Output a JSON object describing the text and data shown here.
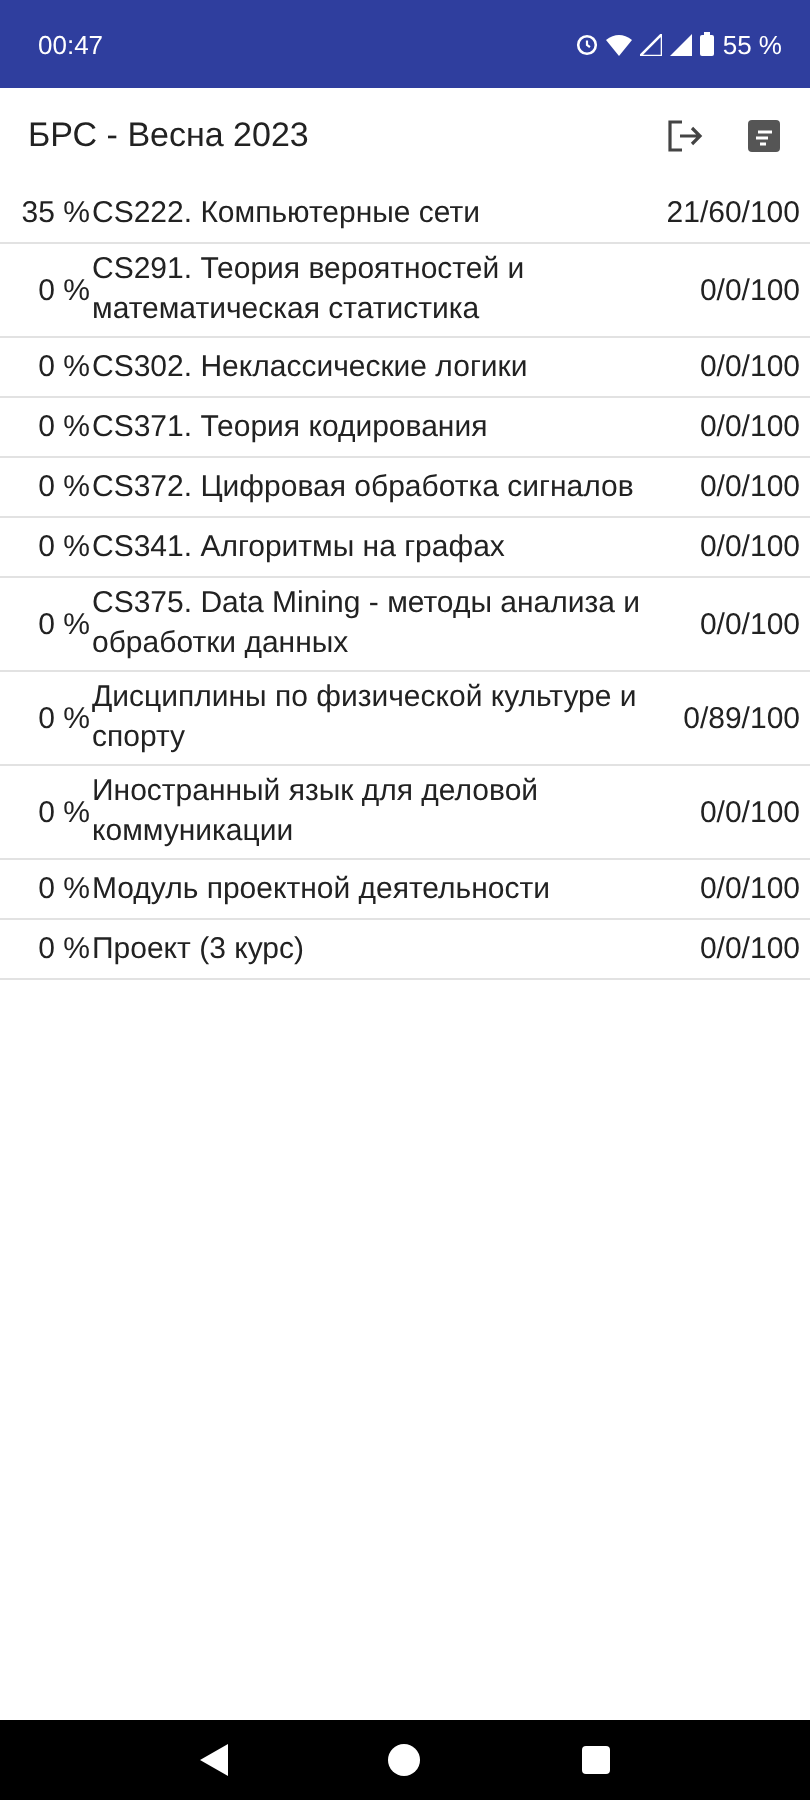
{
  "status_bar": {
    "time": "00:47",
    "battery": "55 %"
  },
  "app_bar": {
    "title": "БРС - Весна 2023"
  },
  "subjects": [
    {
      "percent": "35 %",
      "name": "CS222. Компьютерные сети",
      "score": "21/60/100"
    },
    {
      "percent": "0 %",
      "name": "CS291. Теория вероятностей и математическая статистика",
      "score": "0/0/100"
    },
    {
      "percent": "0 %",
      "name": "CS302. Неклассические логики",
      "score": "0/0/100"
    },
    {
      "percent": "0 %",
      "name": "CS371. Теория кодирования",
      "score": "0/0/100"
    },
    {
      "percent": "0 %",
      "name": "CS372. Цифровая обработка сигналов",
      "score": "0/0/100"
    },
    {
      "percent": "0 %",
      "name": "CS341. Алгоритмы на графах",
      "score": "0/0/100"
    },
    {
      "percent": "0 %",
      "name": "CS375. Data Mining - методы анализа и обработки данных",
      "score": "0/0/100"
    },
    {
      "percent": "0 %",
      "name": "Дисциплины по физической культуре и спорту",
      "score": "0/89/100"
    },
    {
      "percent": "0 %",
      "name": "Иностранный язык для деловой коммуникации",
      "score": "0/0/100"
    },
    {
      "percent": "0 %",
      "name": "Модуль проектной деятельности",
      "score": "0/0/100"
    },
    {
      "percent": "0 %",
      "name": "Проект (3 курс)",
      "score": "0/0/100"
    }
  ]
}
